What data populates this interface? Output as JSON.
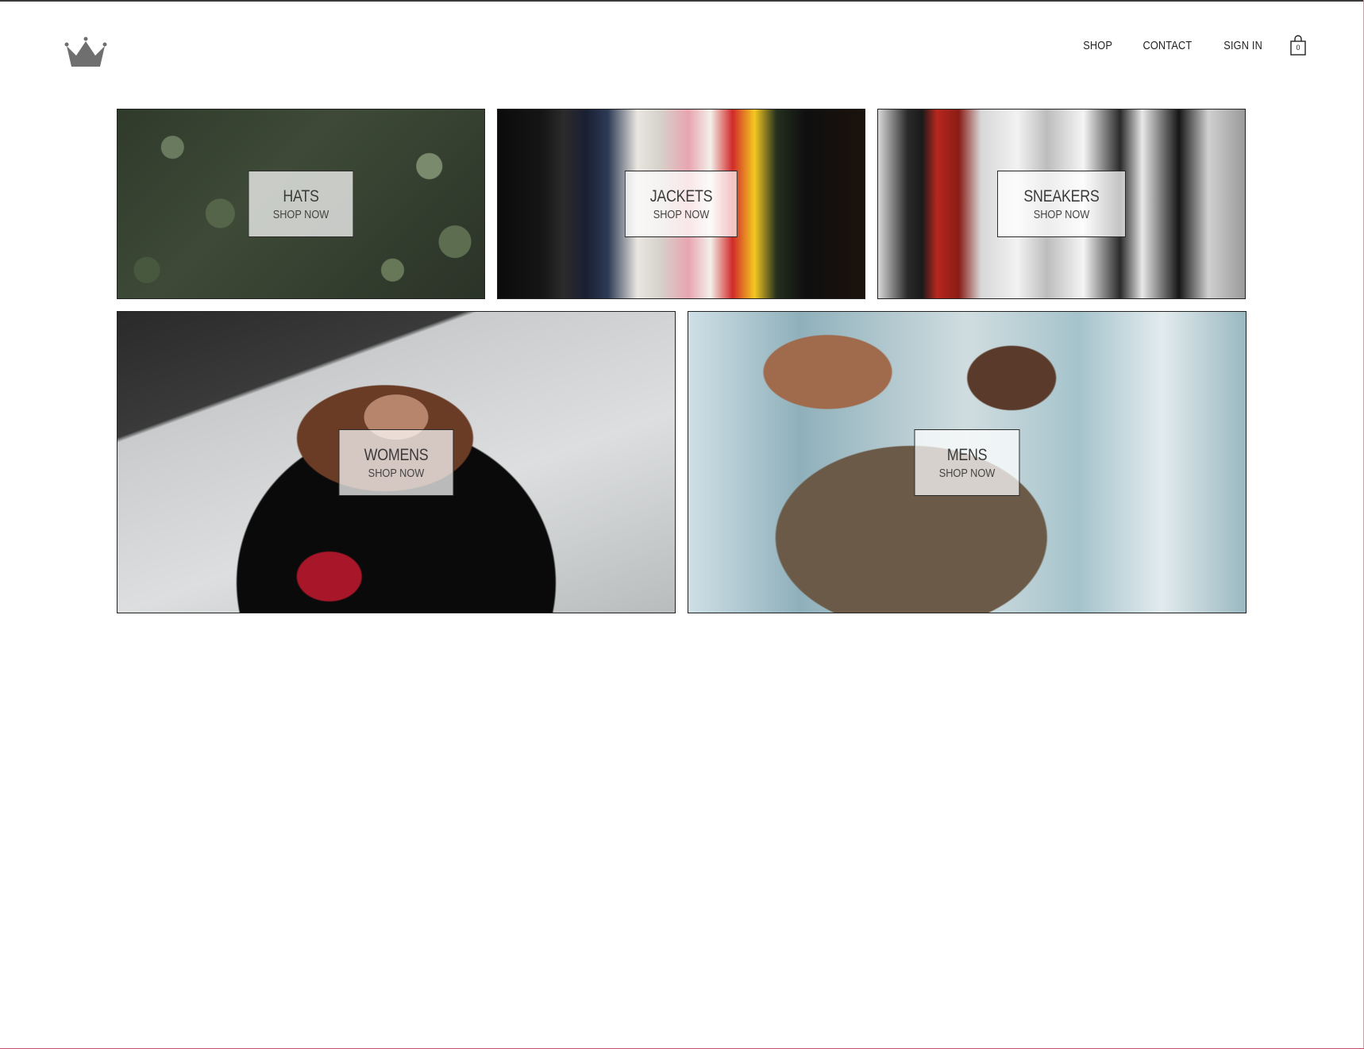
{
  "nav": {
    "shop": "SHOP",
    "contact": "CONTACT",
    "sign_in": "SIGN IN",
    "cart_count": "0"
  },
  "categories": [
    {
      "title": "HATS",
      "subtitle": "SHOP NOW"
    },
    {
      "title": "JACKETS",
      "subtitle": "SHOP NOW"
    },
    {
      "title": "SNEAKERS",
      "subtitle": "SHOP NOW"
    },
    {
      "title": "WOMENS",
      "subtitle": "SHOP NOW"
    },
    {
      "title": "MENS",
      "subtitle": "SHOP NOW"
    }
  ],
  "icons": {
    "logo": "crown-icon",
    "cart": "shopping-bag-icon"
  },
  "colors": {
    "text": "#222222",
    "label_bg": "rgba(255,255,255,0.72)",
    "border": "#222222"
  }
}
